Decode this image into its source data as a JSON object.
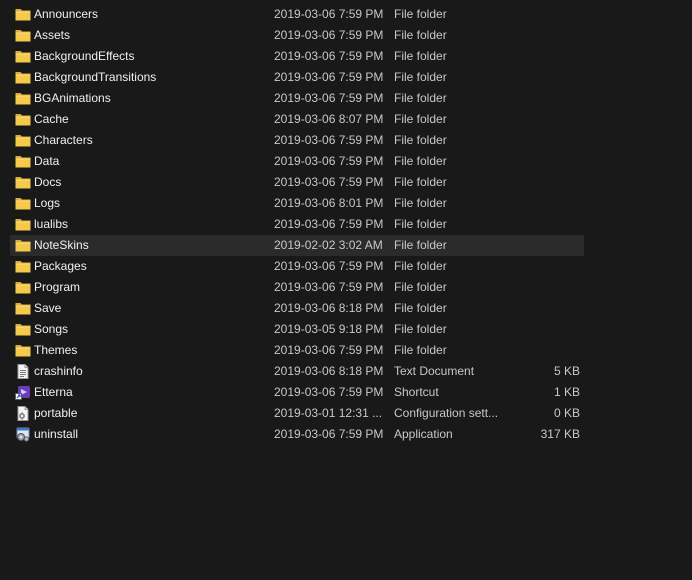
{
  "files": [
    {
      "name": "Announcers",
      "date": "2019-03-06 7:59 PM",
      "type": "File folder",
      "size": "",
      "icon": "folder-icon"
    },
    {
      "name": "Assets",
      "date": "2019-03-06 7:59 PM",
      "type": "File folder",
      "size": "",
      "icon": "folder-icon"
    },
    {
      "name": "BackgroundEffects",
      "date": "2019-03-06 7:59 PM",
      "type": "File folder",
      "size": "",
      "icon": "folder-icon"
    },
    {
      "name": "BackgroundTransitions",
      "date": "2019-03-06 7:59 PM",
      "type": "File folder",
      "size": "",
      "icon": "folder-icon"
    },
    {
      "name": "BGAnimations",
      "date": "2019-03-06 7:59 PM",
      "type": "File folder",
      "size": "",
      "icon": "folder-icon"
    },
    {
      "name": "Cache",
      "date": "2019-03-06 8:07 PM",
      "type": "File folder",
      "size": "",
      "icon": "folder-icon"
    },
    {
      "name": "Characters",
      "date": "2019-03-06 7:59 PM",
      "type": "File folder",
      "size": "",
      "icon": "folder-icon"
    },
    {
      "name": "Data",
      "date": "2019-03-06 7:59 PM",
      "type": "File folder",
      "size": "",
      "icon": "folder-icon"
    },
    {
      "name": "Docs",
      "date": "2019-03-06 7:59 PM",
      "type": "File folder",
      "size": "",
      "icon": "folder-icon"
    },
    {
      "name": "Logs",
      "date": "2019-03-06 8:01 PM",
      "type": "File folder",
      "size": "",
      "icon": "folder-icon"
    },
    {
      "name": "lualibs",
      "date": "2019-03-06 7:59 PM",
      "type": "File folder",
      "size": "",
      "icon": "folder-icon"
    },
    {
      "name": "NoteSkins",
      "date": "2019-02-02 3:02 AM",
      "type": "File folder",
      "size": "",
      "icon": "folder-icon",
      "hovered": true
    },
    {
      "name": "Packages",
      "date": "2019-03-06 7:59 PM",
      "type": "File folder",
      "size": "",
      "icon": "folder-icon"
    },
    {
      "name": "Program",
      "date": "2019-03-06 7:59 PM",
      "type": "File folder",
      "size": "",
      "icon": "folder-icon"
    },
    {
      "name": "Save",
      "date": "2019-03-06 8:18 PM",
      "type": "File folder",
      "size": "",
      "icon": "folder-icon"
    },
    {
      "name": "Songs",
      "date": "2019-03-05 9:18 PM",
      "type": "File folder",
      "size": "",
      "icon": "folder-icon"
    },
    {
      "name": "Themes",
      "date": "2019-03-06 7:59 PM",
      "type": "File folder",
      "size": "",
      "icon": "folder-icon"
    },
    {
      "name": "crashinfo",
      "date": "2019-03-06 8:18 PM",
      "type": "Text Document",
      "size": "5 KB",
      "icon": "text-document-icon"
    },
    {
      "name": "Etterna",
      "date": "2019-03-06 7:59 PM",
      "type": "Shortcut",
      "size": "1 KB",
      "icon": "shortcut-icon"
    },
    {
      "name": "portable",
      "date": "2019-03-01 12:31 ...",
      "type": "Configuration sett...",
      "size": "0 KB",
      "icon": "config-file-icon"
    },
    {
      "name": "uninstall",
      "date": "2019-03-06 7:59 PM",
      "type": "Application",
      "size": "317 KB",
      "icon": "application-icon"
    }
  ],
  "colors": {
    "background": "#191919",
    "hover_row": "#2b2b2b",
    "folder_yellow": "#f5c94a",
    "text": "#e6e6e6"
  }
}
